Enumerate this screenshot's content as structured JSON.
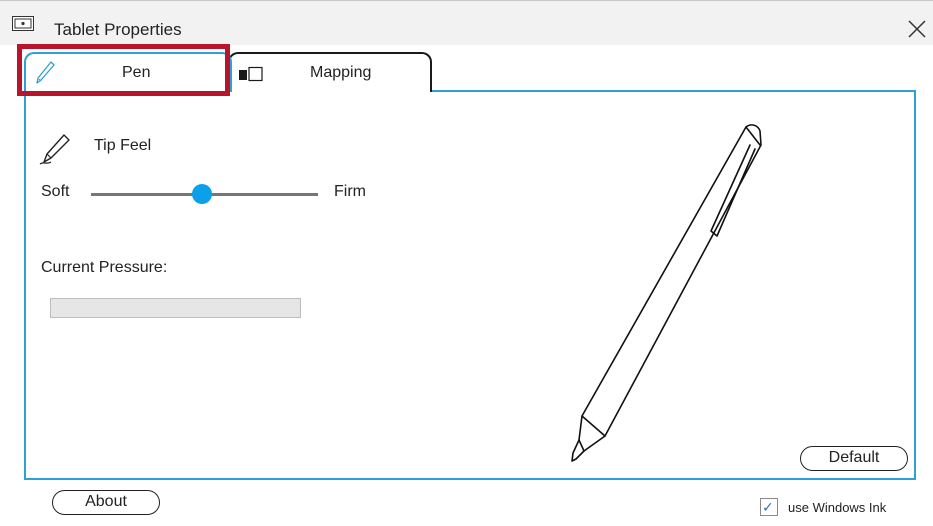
{
  "window": {
    "title": "Tablet Properties"
  },
  "icons": {
    "title": "tablet-properties-icon",
    "close": "close-icon",
    "pen_tab": "pen-icon",
    "mapping_tab": "mapping-icon",
    "tip_feel": "pen-nib-icon"
  },
  "tabs": [
    {
      "label": "Pen",
      "selected": true
    },
    {
      "label": "Mapping",
      "selected": false
    }
  ],
  "pen_panel": {
    "tip_feel_label": "Tip Feel",
    "slider": {
      "min_label": "Soft",
      "max_label": "Firm",
      "level": 0.49
    },
    "pressure_label": "Current Pressure:",
    "pressure_value": 0,
    "default_button": "Default"
  },
  "footer": {
    "about_button": "About",
    "windows_ink": {
      "label": "use Windows Ink",
      "checked": true
    }
  },
  "colors": {
    "accent": "#2f9fd8",
    "slider_thumb": "#0aa0ea",
    "highlight": "#b8142c"
  }
}
